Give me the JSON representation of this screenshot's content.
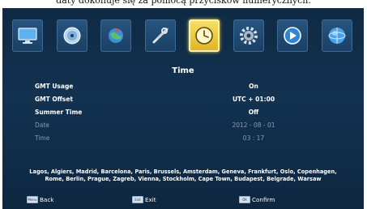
{
  "caption": "daty dokonuje się za pomocą przycisków numerycznych.",
  "menu": {
    "icons": [
      {
        "name": "tv-icon"
      },
      {
        "name": "disc-icon"
      },
      {
        "name": "globe-satellite-icon"
      },
      {
        "name": "tools-icon"
      },
      {
        "name": "clock-icon",
        "active": true
      },
      {
        "name": "gear-icon"
      },
      {
        "name": "play-icon"
      },
      {
        "name": "earth-icon"
      }
    ]
  },
  "title": "Time",
  "settings": [
    {
      "label": "GMT Usage",
      "value": "On"
    },
    {
      "label": "GMT Offset",
      "value": "UTC + 01:00"
    },
    {
      "label": "Summer Time",
      "value": "Off"
    },
    {
      "label": "Date",
      "value": "2012 - 08 - 01"
    },
    {
      "label": "Time",
      "value": "03 : 17"
    }
  ],
  "cities_line1": "Lagos, Algiers, Madrid, Barcelona, Paris, Brussels, Amsterdam, Geneva, Frankfurt, Oslo, Copenhagen,",
  "cities_line2": "Rome, Berlin, Prague, Zagreb, Vienna, Stockholm, Cape Town, Budapest, Belgrade, Warsaw",
  "footer": {
    "back_key": "Menu",
    "back": "Back",
    "exit_key": "Exit",
    "exit": "Exit",
    "confirm_key": "OK",
    "confirm": "Confirm"
  },
  "colors": {
    "active_tile": "#e8c434",
    "background": "#123251",
    "dim_text": "#8a9bb0"
  }
}
